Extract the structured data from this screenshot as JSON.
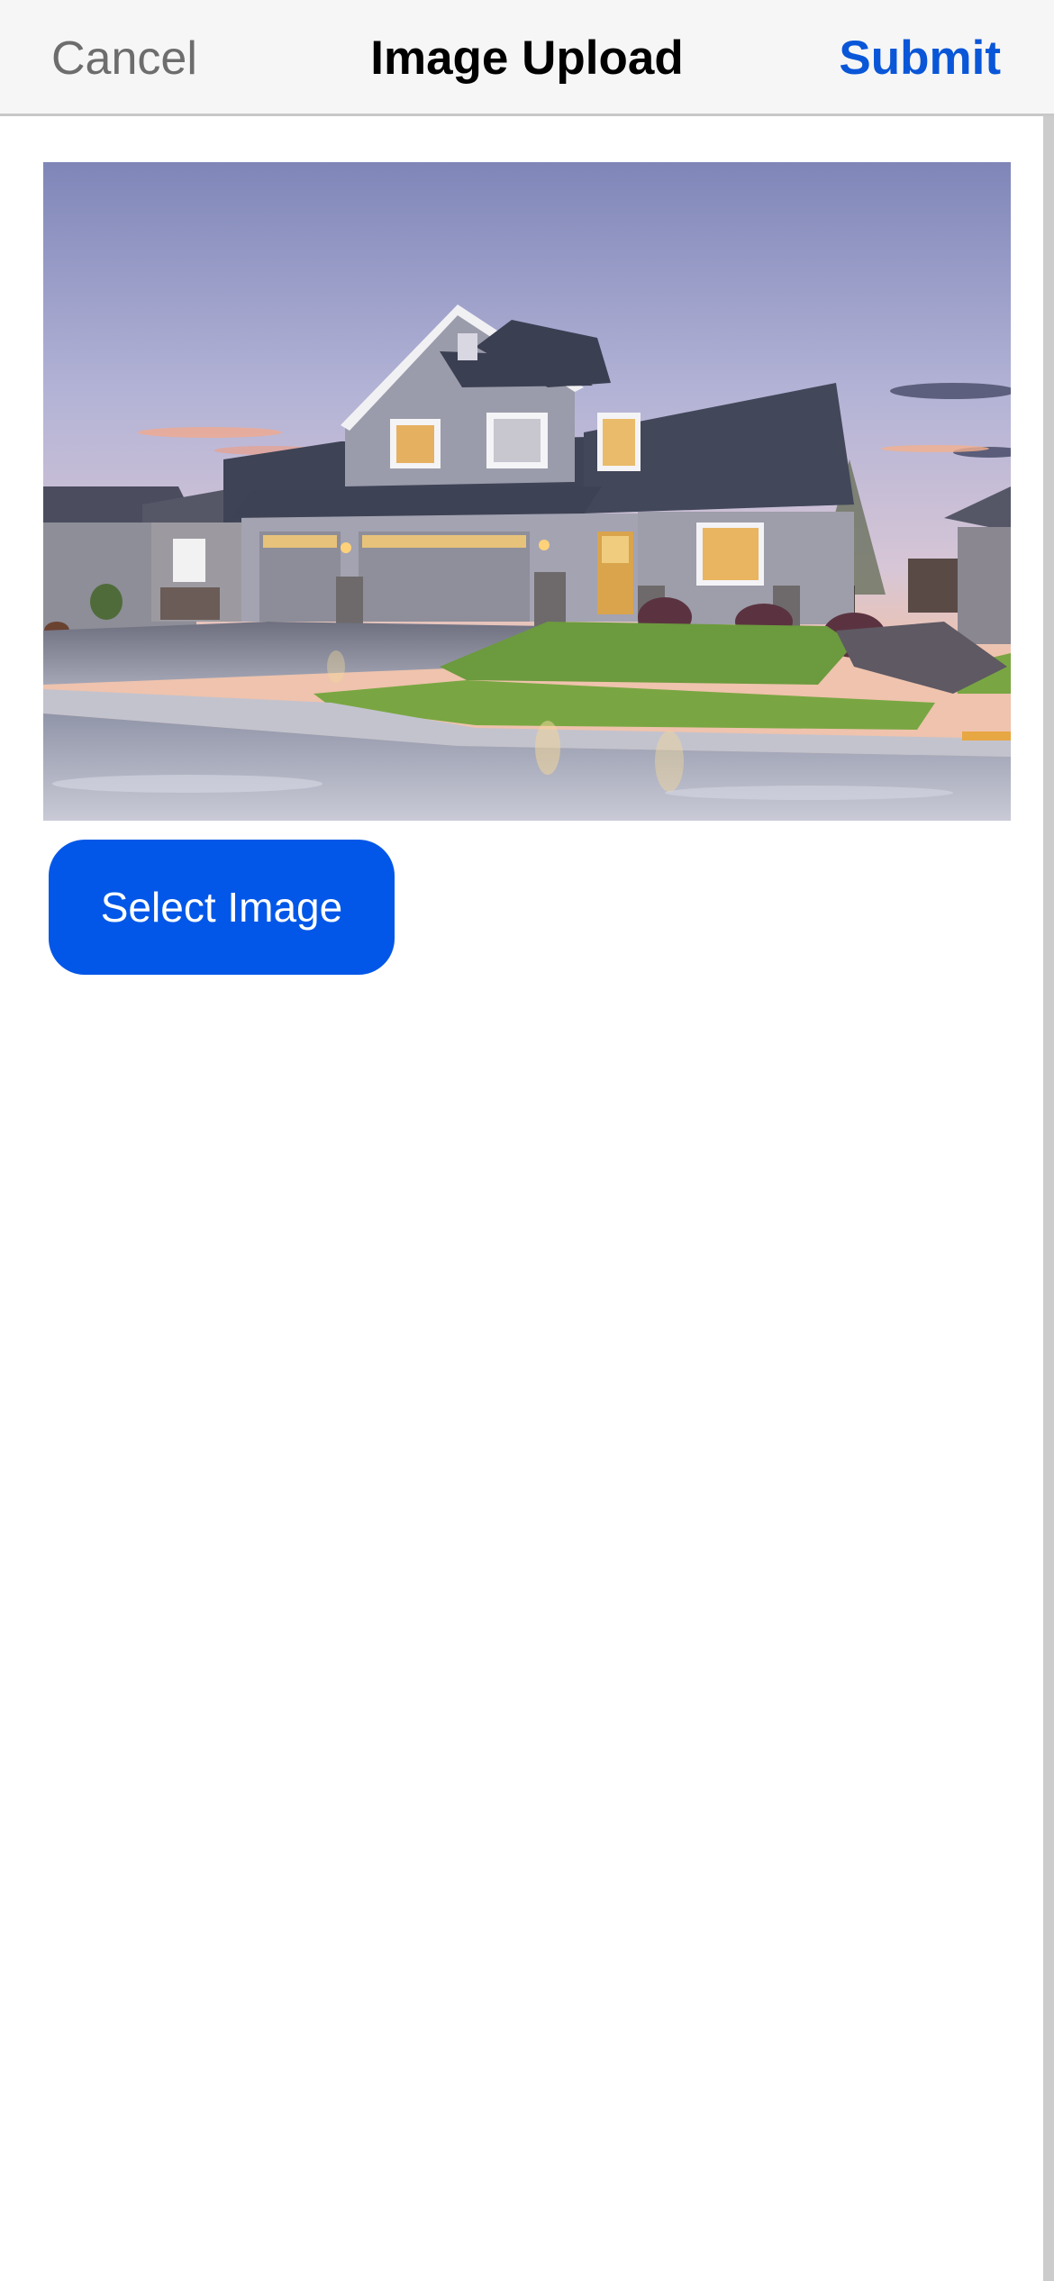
{
  "nav": {
    "cancel_label": "Cancel",
    "title": "Image Upload",
    "submit_label": "Submit"
  },
  "preview": {
    "description_icon": "house-photo"
  },
  "actions": {
    "select_image_label": "Select Image"
  },
  "colors": {
    "accent": "#0a56d8",
    "button": "#0257e8",
    "nav_background": "#f6f6f6",
    "cancel_text": "#6d6d6d"
  }
}
